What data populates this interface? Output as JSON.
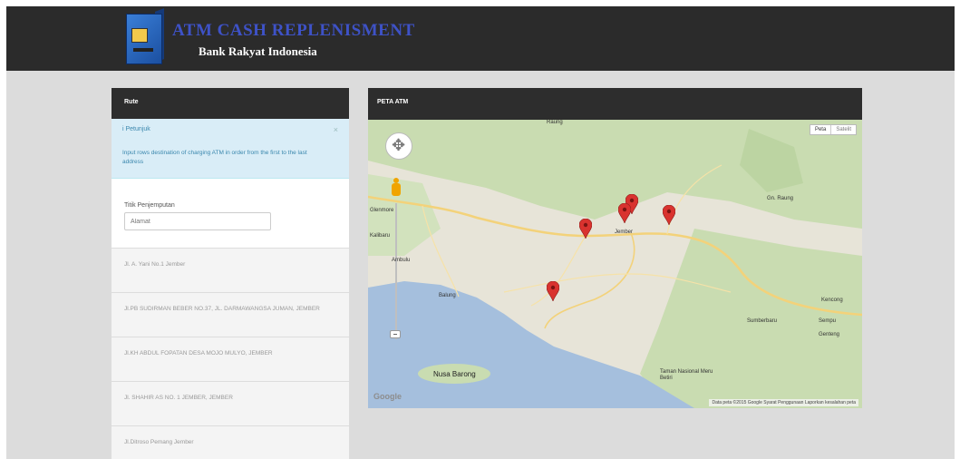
{
  "header": {
    "title": "ATM CASH REPLENISMENT",
    "subtitle": "Bank Rakyat Indonesia"
  },
  "left_panel": {
    "title": "Rute",
    "alert": {
      "title": "i Petunjuk",
      "close": "×",
      "text": "Input rows destination of charging ATM in order from the first to the last address"
    },
    "form": {
      "label": "Titik Penjemputan",
      "placeholder": "Alamat"
    },
    "items": [
      "Jl. A. Yani No.1 Jember",
      "Jl.PB SUDIRMAN BEBER NO.37, JL. DARMAWANGSA JUMAN, JEMBER",
      "Jl.KH ABDUL FOPATAN DESA MOJO MULYO, JEMBER",
      "Jl. SHAHIR AS NO. 1 JEMBER, JEMBER",
      "Jl.Ditroso Pemang Jember"
    ]
  },
  "map_panel": {
    "title": "PETA ATM",
    "toggle": [
      "Peta",
      "Satelit"
    ],
    "places": {
      "top": "Raung",
      "left1": "Glenmore",
      "left2": "Kalibaru",
      "city": "Jember",
      "right": "Gn. Raung",
      "ambulu": "Ambulu",
      "balung": "Balung",
      "kencong": "Kencong",
      "sempu": "Sempu",
      "sumberbaru": "Sumberbaru",
      "genteng": "Genteng",
      "island": "Nusa Barong",
      "park": "Taman Nasional Meru Betiri"
    },
    "google_label": "Google",
    "attribution": "Data peta ©2015 Google  Syarat Penggunaan  Laporkan kesalahan peta",
    "colors": {
      "sea": "#a5bfdd",
      "land": "#e7e4d8",
      "forest": "#c9dcb1",
      "road": "#f3d27a",
      "marker": "#d9332f"
    }
  }
}
